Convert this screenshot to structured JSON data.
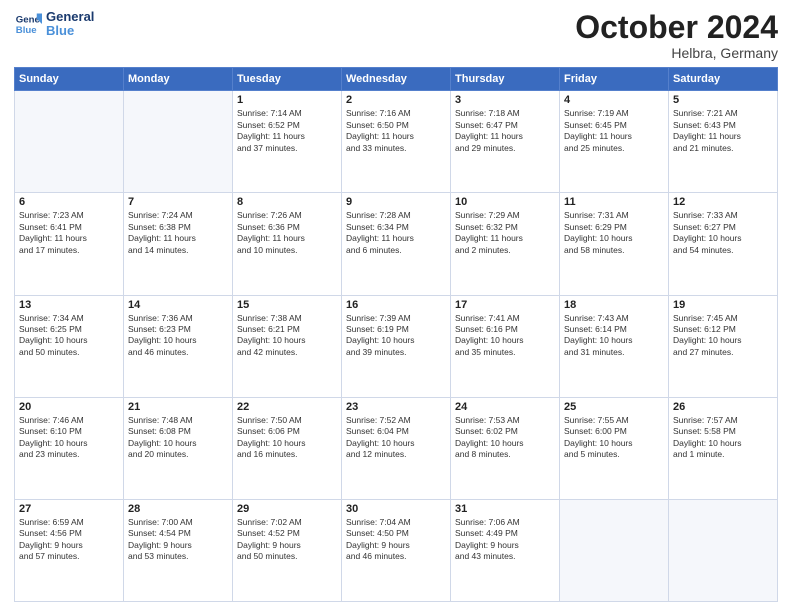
{
  "header": {
    "logo_line1": "General",
    "logo_line2": "Blue",
    "title": "October 2024",
    "subtitle": "Helbra, Germany"
  },
  "days_of_week": [
    "Sunday",
    "Monday",
    "Tuesday",
    "Wednesday",
    "Thursday",
    "Friday",
    "Saturday"
  ],
  "weeks": [
    [
      {
        "day": "",
        "text": ""
      },
      {
        "day": "",
        "text": ""
      },
      {
        "day": "1",
        "text": "Sunrise: 7:14 AM\nSunset: 6:52 PM\nDaylight: 11 hours\nand 37 minutes."
      },
      {
        "day": "2",
        "text": "Sunrise: 7:16 AM\nSunset: 6:50 PM\nDaylight: 11 hours\nand 33 minutes."
      },
      {
        "day": "3",
        "text": "Sunrise: 7:18 AM\nSunset: 6:47 PM\nDaylight: 11 hours\nand 29 minutes."
      },
      {
        "day": "4",
        "text": "Sunrise: 7:19 AM\nSunset: 6:45 PM\nDaylight: 11 hours\nand 25 minutes."
      },
      {
        "day": "5",
        "text": "Sunrise: 7:21 AM\nSunset: 6:43 PM\nDaylight: 11 hours\nand 21 minutes."
      }
    ],
    [
      {
        "day": "6",
        "text": "Sunrise: 7:23 AM\nSunset: 6:41 PM\nDaylight: 11 hours\nand 17 minutes."
      },
      {
        "day": "7",
        "text": "Sunrise: 7:24 AM\nSunset: 6:38 PM\nDaylight: 11 hours\nand 14 minutes."
      },
      {
        "day": "8",
        "text": "Sunrise: 7:26 AM\nSunset: 6:36 PM\nDaylight: 11 hours\nand 10 minutes."
      },
      {
        "day": "9",
        "text": "Sunrise: 7:28 AM\nSunset: 6:34 PM\nDaylight: 11 hours\nand 6 minutes."
      },
      {
        "day": "10",
        "text": "Sunrise: 7:29 AM\nSunset: 6:32 PM\nDaylight: 11 hours\nand 2 minutes."
      },
      {
        "day": "11",
        "text": "Sunrise: 7:31 AM\nSunset: 6:29 PM\nDaylight: 10 hours\nand 58 minutes."
      },
      {
        "day": "12",
        "text": "Sunrise: 7:33 AM\nSunset: 6:27 PM\nDaylight: 10 hours\nand 54 minutes."
      }
    ],
    [
      {
        "day": "13",
        "text": "Sunrise: 7:34 AM\nSunset: 6:25 PM\nDaylight: 10 hours\nand 50 minutes."
      },
      {
        "day": "14",
        "text": "Sunrise: 7:36 AM\nSunset: 6:23 PM\nDaylight: 10 hours\nand 46 minutes."
      },
      {
        "day": "15",
        "text": "Sunrise: 7:38 AM\nSunset: 6:21 PM\nDaylight: 10 hours\nand 42 minutes."
      },
      {
        "day": "16",
        "text": "Sunrise: 7:39 AM\nSunset: 6:19 PM\nDaylight: 10 hours\nand 39 minutes."
      },
      {
        "day": "17",
        "text": "Sunrise: 7:41 AM\nSunset: 6:16 PM\nDaylight: 10 hours\nand 35 minutes."
      },
      {
        "day": "18",
        "text": "Sunrise: 7:43 AM\nSunset: 6:14 PM\nDaylight: 10 hours\nand 31 minutes."
      },
      {
        "day": "19",
        "text": "Sunrise: 7:45 AM\nSunset: 6:12 PM\nDaylight: 10 hours\nand 27 minutes."
      }
    ],
    [
      {
        "day": "20",
        "text": "Sunrise: 7:46 AM\nSunset: 6:10 PM\nDaylight: 10 hours\nand 23 minutes."
      },
      {
        "day": "21",
        "text": "Sunrise: 7:48 AM\nSunset: 6:08 PM\nDaylight: 10 hours\nand 20 minutes."
      },
      {
        "day": "22",
        "text": "Sunrise: 7:50 AM\nSunset: 6:06 PM\nDaylight: 10 hours\nand 16 minutes."
      },
      {
        "day": "23",
        "text": "Sunrise: 7:52 AM\nSunset: 6:04 PM\nDaylight: 10 hours\nand 12 minutes."
      },
      {
        "day": "24",
        "text": "Sunrise: 7:53 AM\nSunset: 6:02 PM\nDaylight: 10 hours\nand 8 minutes."
      },
      {
        "day": "25",
        "text": "Sunrise: 7:55 AM\nSunset: 6:00 PM\nDaylight: 10 hours\nand 5 minutes."
      },
      {
        "day": "26",
        "text": "Sunrise: 7:57 AM\nSunset: 5:58 PM\nDaylight: 10 hours\nand 1 minute."
      }
    ],
    [
      {
        "day": "27",
        "text": "Sunrise: 6:59 AM\nSunset: 4:56 PM\nDaylight: 9 hours\nand 57 minutes."
      },
      {
        "day": "28",
        "text": "Sunrise: 7:00 AM\nSunset: 4:54 PM\nDaylight: 9 hours\nand 53 minutes."
      },
      {
        "day": "29",
        "text": "Sunrise: 7:02 AM\nSunset: 4:52 PM\nDaylight: 9 hours\nand 50 minutes."
      },
      {
        "day": "30",
        "text": "Sunrise: 7:04 AM\nSunset: 4:50 PM\nDaylight: 9 hours\nand 46 minutes."
      },
      {
        "day": "31",
        "text": "Sunrise: 7:06 AM\nSunset: 4:49 PM\nDaylight: 9 hours\nand 43 minutes."
      },
      {
        "day": "",
        "text": ""
      },
      {
        "day": "",
        "text": ""
      }
    ]
  ]
}
